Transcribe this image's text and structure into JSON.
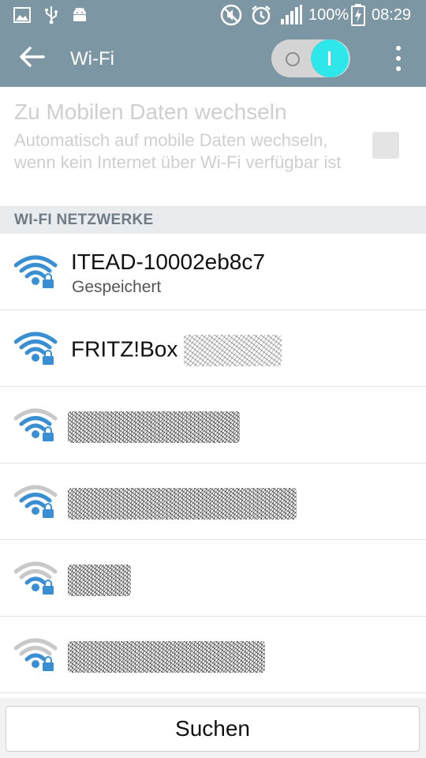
{
  "status_bar": {
    "icons_left": [
      "image-icon",
      "usb-icon",
      "android-icon"
    ],
    "icons_right": [
      "mute-icon",
      "alarm-icon",
      "signal-icon"
    ],
    "battery": "100%",
    "time": "08:29"
  },
  "action_bar": {
    "title": "Wi-Fi",
    "toggle_state": "on",
    "toggle_on_glyph": "I",
    "toggle_off_glyph": "O",
    "accent_color": "#2ee7eb",
    "bar_color": "#7d96a3"
  },
  "mobile_data_setting": {
    "title": "Zu Mobilen Daten wechseln",
    "summary": "Automatisch auf mobile Daten wechseln, wenn kein Internet über Wi-Fi verfügbar ist",
    "checked": false,
    "enabled": false
  },
  "networks_section": {
    "header": "WI-FI NETZWERKE",
    "items": [
      {
        "name": "ITEAD-10002eb8c7",
        "status": "Gespeichert",
        "signal": 3,
        "secured": true,
        "icon_color": "#3a8fd3"
      },
      {
        "name": "FRITZ!Box",
        "status": "",
        "signal": 3,
        "secured": true,
        "icon_color": "#3a8fd3",
        "redacted_suffix": true
      },
      {
        "name": "",
        "status": "",
        "signal": 2,
        "secured": true,
        "icon_color": "#3a8fd3",
        "redacted": true
      },
      {
        "name": "",
        "status": "",
        "signal": 2,
        "secured": true,
        "icon_color": "#3a8fd3",
        "redacted": true
      },
      {
        "name": "",
        "status": "",
        "signal": 1,
        "secured": true,
        "icon_color": "#3a8fd3",
        "redacted": true
      },
      {
        "name": "",
        "status": "",
        "signal": 1,
        "secured": true,
        "icon_color": "#3a8fd3",
        "redacted": true
      }
    ]
  },
  "bottom": {
    "search_label": "Suchen"
  }
}
